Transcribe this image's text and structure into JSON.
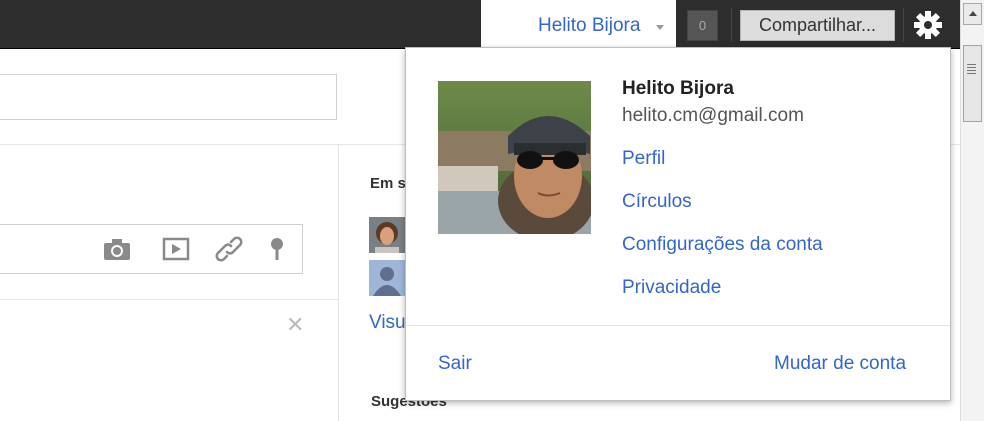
{
  "topbar": {
    "user_name": "Helito Bijora",
    "notification_count": "0",
    "share_label": "Compartilhar..."
  },
  "page": {
    "sidebar_heading": "Em s",
    "visualize_link": "Visu",
    "suggestions_heading": "Sugestões",
    "share_icons": [
      "camera-icon",
      "video-icon",
      "link-icon",
      "location-icon"
    ]
  },
  "dropdown": {
    "name": "Helito Bijora",
    "email": "helito.cm@gmail.com",
    "links": [
      "Perfil",
      "Círculos",
      "Configurações da conta",
      "Privacidade"
    ],
    "sign_out": "Sair",
    "switch_account": "Mudar de conta"
  },
  "colors": {
    "link": "#3366cc",
    "topbar_bg": "#2d2d2d"
  }
}
